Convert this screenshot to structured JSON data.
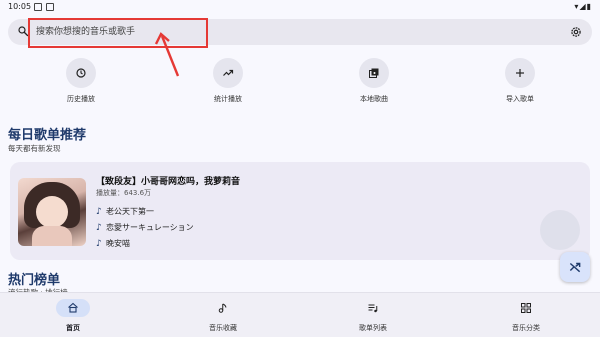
{
  "status_bar": {
    "time": "10:05"
  },
  "search": {
    "placeholder": "搜索你想搜的音乐或歌手"
  },
  "quick_actions": [
    {
      "label": "历史播放",
      "icon": "history-icon"
    },
    {
      "label": "统计播放",
      "icon": "trending-icon"
    },
    {
      "label": "本地歌曲",
      "icon": "local-music-icon"
    },
    {
      "label": "导入歌单",
      "icon": "plus-icon"
    }
  ],
  "daily": {
    "title": "每日歌单推荐",
    "subtitle": "每天都有新发现",
    "card": {
      "title": "【致段友】小哥哥网恋吗，我萝莉音",
      "plays": "播放量：643.6万",
      "songs": [
        "老公天下第一",
        "恋愛サーキュレーション",
        "晚安喵"
      ]
    }
  },
  "hot": {
    "title": "热门榜单",
    "subtitle": "流行热歌 · 排行榜"
  },
  "bottom_nav": [
    {
      "label": "首页",
      "icon": "home-icon",
      "active": true
    },
    {
      "label": "音乐收藏",
      "icon": "music-collection-icon"
    },
    {
      "label": "歌单列表",
      "icon": "playlist-icon"
    },
    {
      "label": "音乐分类",
      "icon": "category-icon"
    }
  ],
  "colors": {
    "accent": "#1f3a6b",
    "annotation": "#e53935"
  }
}
